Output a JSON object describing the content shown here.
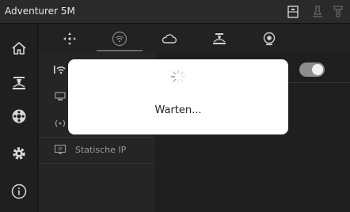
{
  "titlebar": {
    "title": "Adventurer 5M",
    "icons": [
      "printer-status-icon",
      "nozzle-status-icon",
      "filament-status-icon"
    ]
  },
  "nav": {
    "items": [
      "home-icon",
      "print-head-icon",
      "filament-spool-icon",
      "settings-gear-icon",
      "info-icon"
    ]
  },
  "tabs": [
    {
      "icon": "move-axes-icon",
      "active": false
    },
    {
      "icon": "wifi-icon",
      "active": true
    },
    {
      "icon": "cloud-icon",
      "active": false
    },
    {
      "icon": "printer-network-icon",
      "active": false
    },
    {
      "icon": "camera-icon",
      "active": false
    }
  ],
  "network_list": {
    "items": [
      {
        "icon": "wifi-icon",
        "label": ""
      },
      {
        "icon": "ethernet-icon",
        "label": ""
      },
      {
        "icon": "hotspot-icon",
        "label": ""
      },
      {
        "icon": "ip-icon",
        "label": "Statische IP"
      }
    ]
  },
  "toggle": {
    "state": "on"
  },
  "dialog": {
    "message": "Warten..."
  },
  "colors": {
    "background": "#1b1b1b",
    "titlebar": "#2a2a2a",
    "dialog": "#ffffff",
    "toggle_track": "#8e8e8e"
  }
}
